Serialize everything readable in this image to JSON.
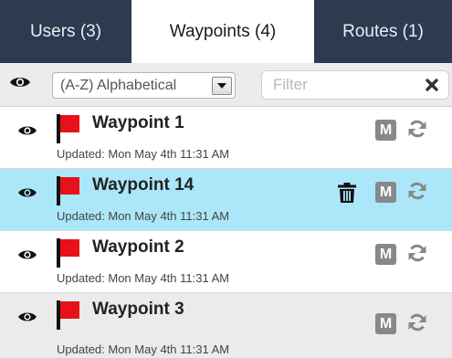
{
  "tabs": [
    {
      "label": "Users (3)"
    },
    {
      "label": "Waypoints (4)"
    },
    {
      "label": "Routes (1)"
    }
  ],
  "toolbar": {
    "sort_value": "(A-Z) Alphabetical",
    "filter_placeholder": "Filter"
  },
  "waypoints": [
    {
      "name": "Waypoint 1",
      "updated": "Updated: Mon May 4th 11:31 AM",
      "m_label": "M"
    },
    {
      "name": "Waypoint 14",
      "updated": "Updated: Mon May 4th 11:31 AM",
      "m_label": "M"
    },
    {
      "name": "Waypoint 2",
      "updated": "Updated: Mon May 4th 11:31 AM",
      "m_label": "M"
    },
    {
      "name": "Waypoint 3",
      "updated": "Updated: Mon May 4th 11:31 AM",
      "m_label": "M"
    }
  ],
  "colors": {
    "tab_dark": "#2d3a4f",
    "selected_row": "#abe7f8",
    "flag_red": "#e8101a",
    "badge_grey": "#888888"
  }
}
